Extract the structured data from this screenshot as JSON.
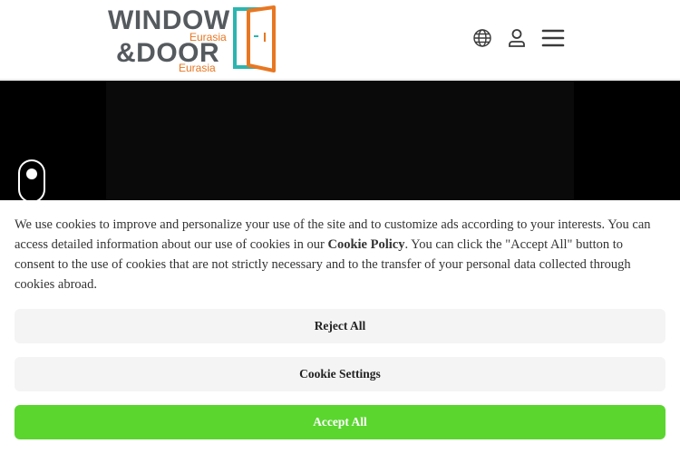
{
  "logo": {
    "line1": "WINDOW",
    "line2": "&DOOR",
    "sub1": "Eurasia",
    "sub2": "Eurasia",
    "primary_color": "#555a5f",
    "accent_color": "#e87722",
    "door_colors": [
      "#2bb5b0",
      "#e87722"
    ]
  },
  "header": {
    "icons": [
      "globe-icon",
      "user-icon",
      "menu-icon"
    ],
    "icon_color": "#3a3a3a"
  },
  "stage": {
    "background": "#000000",
    "scroll_indicator": "mouse-scroll-icon"
  },
  "cookie": {
    "text_before": "We use cookies to improve and personalize your use of the site and to customize ads according to your interests. You can access detailed information about our use of cookies in our ",
    "policy_link": "Cookie Policy",
    "text_after": ". You can click the \"Accept All\" button to consent to the use of cookies that are not strictly necessary and to the transfer of your personal data collected through cookies abroad.",
    "reject_label": "Reject All",
    "settings_label": "Cookie Settings",
    "accept_label": "Accept All",
    "accept_color": "#5ad62f",
    "neutral_button_color": "#f4f4f4"
  }
}
